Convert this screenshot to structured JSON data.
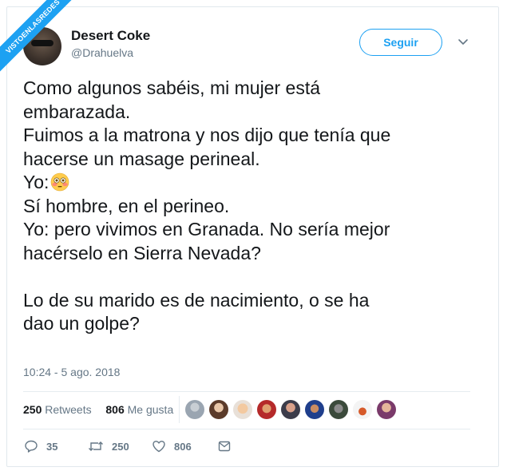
{
  "watermark": "VISTOENLASREDES",
  "author": {
    "name": "Desert Coke",
    "handle": "@Drahuelva"
  },
  "follow_label": "Seguir",
  "tweet": {
    "lines": [
      "Como algunos sabéis, mi mujer está",
      "embarazada.",
      "Fuimos a la matrona y nos dijo que tenía que",
      "hacerse un masage perineal.",
      "Yo:",
      "Sí hombre, en el perineo.",
      "Yo: pero vivimos en Granada. No sería mejor",
      "hacérselo en Sierra Nevada?",
      "",
      "Lo de su marido es de nacimiento, o se ha",
      "dao un golpe?"
    ]
  },
  "timestamp": "10:24 - 5 ago. 2018",
  "stats": {
    "retweets_count": "250",
    "retweets_label": "Retweets",
    "likes_count": "806",
    "likes_label": "Me gusta"
  },
  "actions": {
    "replies": "35",
    "retweets": "250",
    "likes": "806"
  },
  "colors": {
    "accent": "#1da1f2",
    "text": "#14171a",
    "secondary": "#657786",
    "border": "#e6ecf0"
  },
  "icons": [
    "reply-icon",
    "retweet-icon",
    "like-icon",
    "message-icon",
    "chevron-down-icon",
    "flushed-face-emoji"
  ]
}
